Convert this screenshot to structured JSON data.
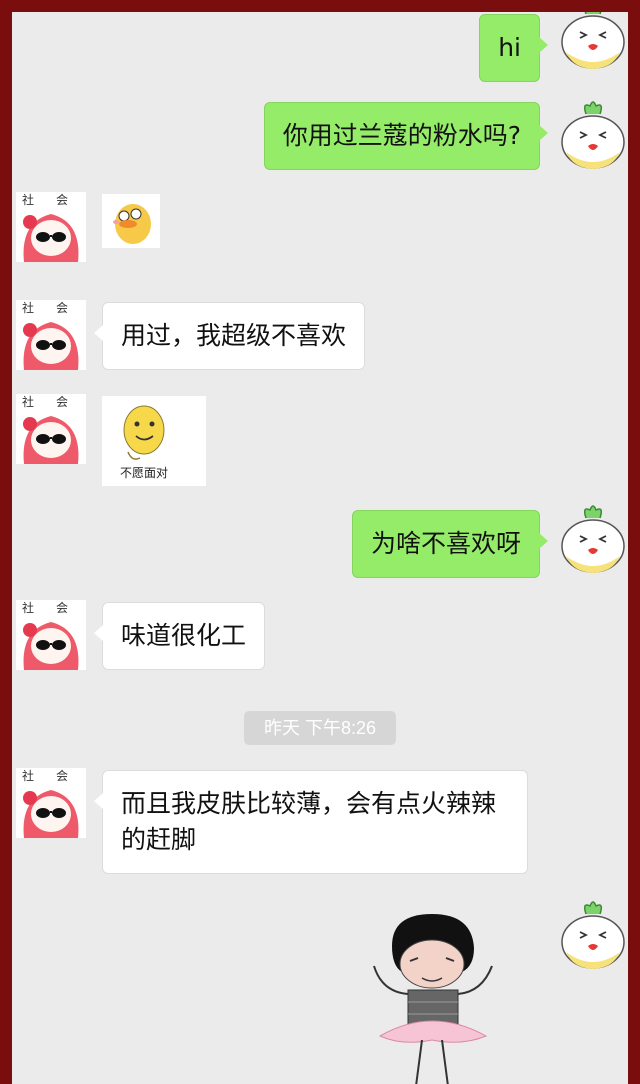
{
  "colors": {
    "frame": "#7a0d0d",
    "chat_bg": "#ebebeb",
    "outgoing_bubble": "#95ec69",
    "incoming_bubble": "#ffffff",
    "timestamp_pill": "#d6d6d6"
  },
  "contact_avatar": {
    "label_left": "社",
    "label_right": "会"
  },
  "messages": [
    {
      "direction": "outgoing",
      "type": "text",
      "text": "hi"
    },
    {
      "direction": "outgoing",
      "type": "text",
      "text": "你用过兰蔻的粉水吗?"
    },
    {
      "direction": "incoming",
      "type": "sticker",
      "sticker": "yellow-duck"
    },
    {
      "direction": "incoming",
      "type": "text",
      "text": "用过，我超级不喜欢"
    },
    {
      "direction": "incoming",
      "type": "sticker",
      "sticker": "smiley-face",
      "caption": "不愿面对"
    },
    {
      "direction": "outgoing",
      "type": "text",
      "text": "为啥不喜欢呀"
    },
    {
      "direction": "incoming",
      "type": "text",
      "text": "味道很化工"
    },
    {
      "direction": "incoming",
      "type": "text",
      "text": "而且我皮肤比较薄，会有点火辣辣的赶脚"
    },
    {
      "direction": "outgoing",
      "type": "sticker",
      "sticker": "ballerina-cartoon"
    }
  ],
  "timestamp": "昨天 下午8:26"
}
